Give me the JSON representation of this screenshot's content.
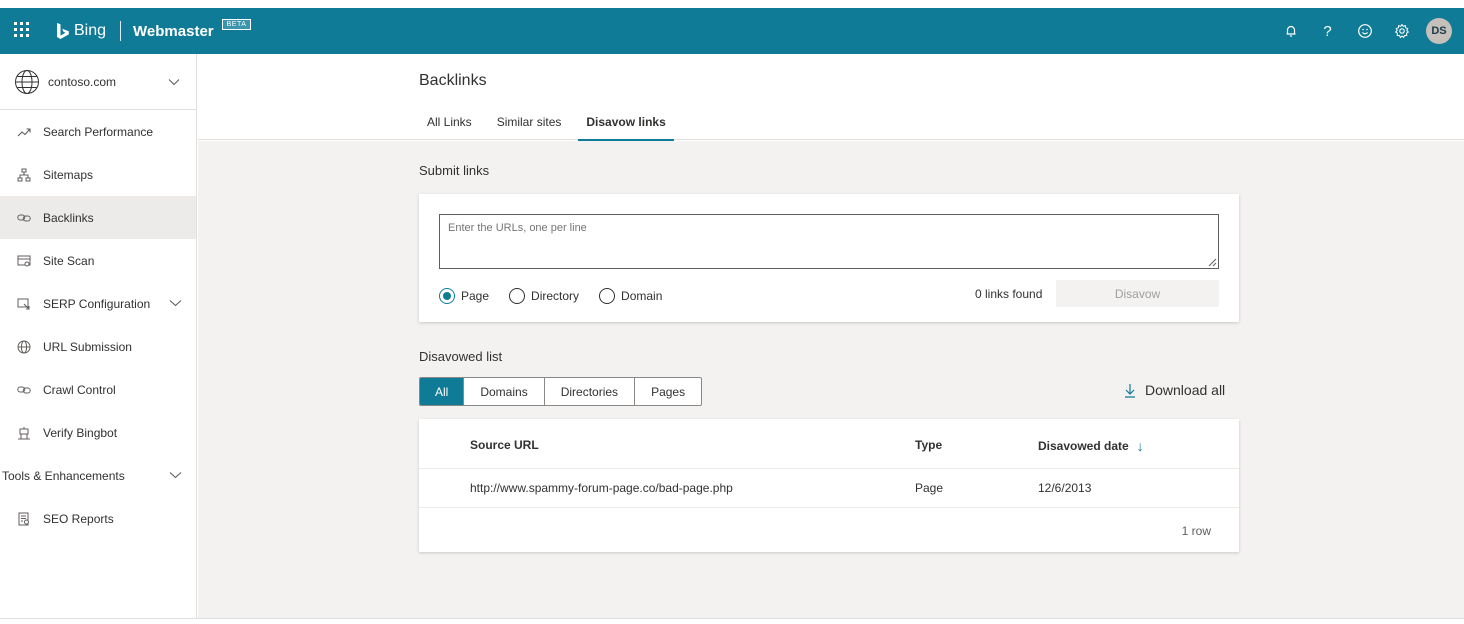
{
  "topbar": {
    "bing_label": "Bing",
    "product_label": "Webmaster",
    "beta_label": "BETA",
    "avatar_initials": "DS",
    "help_glyph": "?",
    "bg_color": "#0f7b96"
  },
  "sidebar": {
    "site_name": "contoso.com",
    "items": [
      {
        "label": "Search Performance",
        "icon": "trend-icon"
      },
      {
        "label": "Sitemaps",
        "icon": "sitemap-icon"
      },
      {
        "label": "Backlinks",
        "icon": "link-icon",
        "active": true
      },
      {
        "label": "Site Scan",
        "icon": "scan-icon"
      },
      {
        "label": "SERP Configuration",
        "icon": "serp-icon",
        "expandable": true
      },
      {
        "label": "URL Submission",
        "icon": "globe-icon"
      },
      {
        "label": "Crawl Control",
        "icon": "link-icon"
      },
      {
        "label": "Verify Bingbot",
        "icon": "robot-icon"
      },
      {
        "label": "Tools & Enhancements",
        "expandable": true
      },
      {
        "label": "SEO Reports",
        "icon": "report-icon"
      }
    ]
  },
  "page": {
    "title": "Backlinks",
    "tabs": [
      "All Links",
      "Similar sites",
      "Disavow links"
    ],
    "selected_tab": "Disavow links"
  },
  "submit": {
    "title": "Submit links",
    "placeholder": "Enter the URLs, one per line",
    "radios": [
      "Page",
      "Directory",
      "Domain"
    ],
    "selected_radio": "Page",
    "links_found": "0 links found",
    "disavow_label": "Disavow"
  },
  "disavowed": {
    "title": "Disavowed list",
    "filters": [
      "All",
      "Domains",
      "Directories",
      "Pages"
    ],
    "selected_filter": "All",
    "download_label": "Download all",
    "columns": [
      "Source URL",
      "Type",
      "Disavowed date"
    ],
    "sort_glyph": "↓",
    "rows": [
      {
        "source_url": "http://www.spammy-forum-page.co/bad-page.php",
        "type": "Page",
        "date": "12/6/2013"
      }
    ],
    "row_count": "1 row"
  }
}
